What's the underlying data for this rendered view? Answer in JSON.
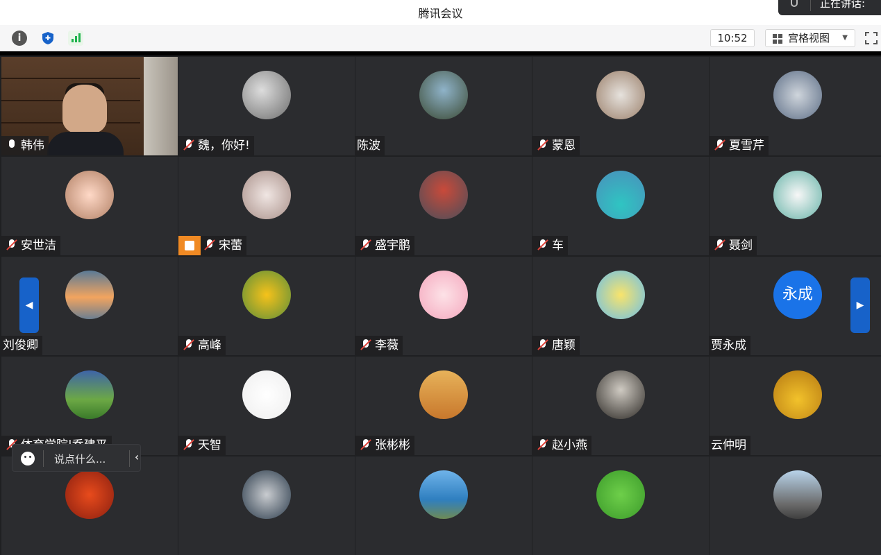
{
  "app": {
    "title": "腾讯会议",
    "speaking_label": "正在讲话:"
  },
  "toolbar": {
    "info_icon": "info-icon",
    "shield_icon": "shield-icon",
    "signal_icon": "signal-icon",
    "clock": "10:52",
    "view_mode": "宫格视图",
    "fullscreen_icon": "fullscreen-icon"
  },
  "participants": [
    {
      "name": "韩伟",
      "muted": false,
      "video": true
    },
    {
      "name": "魏，你好!",
      "muted": true
    },
    {
      "name": "陈波",
      "muted": null
    },
    {
      "name": "蒙恩",
      "muted": true
    },
    {
      "name": "夏雪芹",
      "muted": true
    },
    {
      "name": "安世洁",
      "muted": true
    },
    {
      "name": "宋蕾",
      "muted": true,
      "host": true
    },
    {
      "name": "盛宇鹏",
      "muted": true
    },
    {
      "name": "车",
      "muted": true
    },
    {
      "name": "聂剑",
      "muted": true
    },
    {
      "name": "刘俊卿",
      "muted": null
    },
    {
      "name": "高峰",
      "muted": true
    },
    {
      "name": "李薇",
      "muted": true
    },
    {
      "name": "唐颖",
      "muted": true
    },
    {
      "name": "贾永成",
      "muted": null,
      "avatar_text": "永成"
    },
    {
      "name": "体育学院|乔建平",
      "muted": true
    },
    {
      "name": "天智",
      "muted": true
    },
    {
      "name": "张彬彬",
      "muted": true
    },
    {
      "name": "赵小燕",
      "muted": true
    },
    {
      "name": "云仲明",
      "muted": null
    }
  ],
  "chat": {
    "placeholder": "说点什么..."
  },
  "colors": {
    "accent": "#1762c9",
    "host_badge": "#f08a24",
    "mute_slash": "#e2453c"
  }
}
